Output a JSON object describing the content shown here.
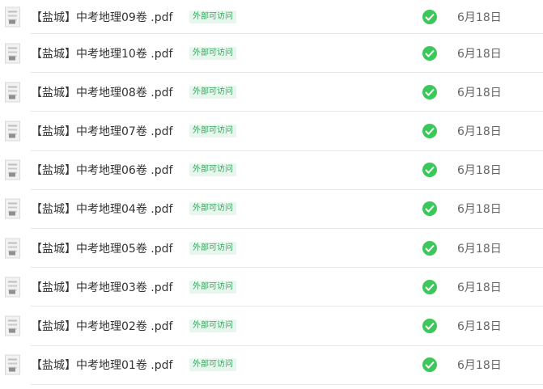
{
  "files": [
    {
      "name": "【盐城】中考地理09卷 .pdf",
      "badge": "外部可访问",
      "date": "6月18日"
    },
    {
      "name": "【盐城】中考地理10卷 .pdf",
      "badge": "外部可访问",
      "date": "6月18日"
    },
    {
      "name": "【盐城】中考地理08卷 .pdf",
      "badge": "外部可访问",
      "date": "6月18日"
    },
    {
      "name": "【盐城】中考地理07卷 .pdf",
      "badge": "外部可访问",
      "date": "6月18日"
    },
    {
      "name": "【盐城】中考地理06卷 .pdf",
      "badge": "外部可访问",
      "date": "6月18日"
    },
    {
      "name": "【盐城】中考地理04卷 .pdf",
      "badge": "外部可访问",
      "date": "6月18日"
    },
    {
      "name": "【盐城】中考地理05卷 .pdf",
      "badge": "外部可访问",
      "date": "6月18日"
    },
    {
      "name": "【盐城】中考地理03卷 .pdf",
      "badge": "外部可访问",
      "date": "6月18日"
    },
    {
      "name": "【盐城】中考地理02卷 .pdf",
      "badge": "外部可访问",
      "date": "6月18日"
    },
    {
      "name": "【盐城】中考地理01卷 .pdf",
      "badge": "外部可访问",
      "date": "6月18日"
    }
  ],
  "icons": {
    "thumbnail": "pdf-thumbnail-icon",
    "status": "check-circle-icon"
  },
  "colors": {
    "status_green": "#3cc75a",
    "badge_text": "#3aa65f",
    "badge_bg": "#e8f7ee"
  }
}
